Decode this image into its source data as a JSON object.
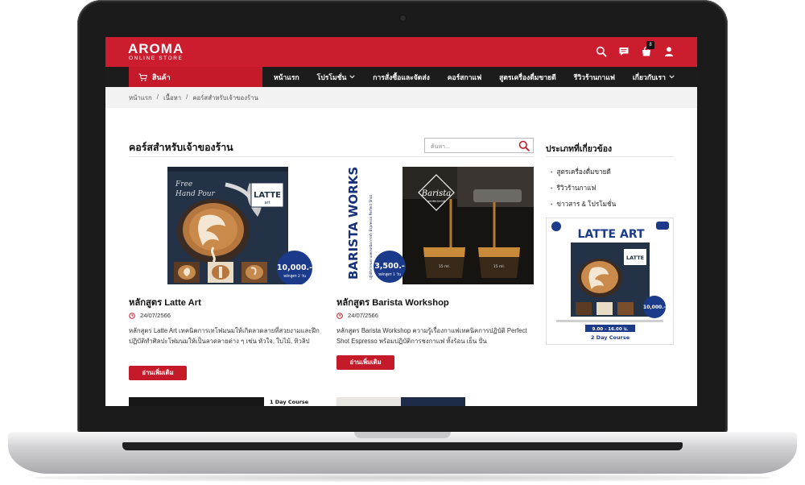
{
  "brand": {
    "name": "AROMA",
    "tagline": "ONLINE STORE"
  },
  "header": {
    "icons": [
      "search-icon",
      "chat-icon",
      "cart-icon",
      "user-icon"
    ],
    "cart_count": "8"
  },
  "nav": {
    "products_label": "สินค้า",
    "items": [
      {
        "label": "หน้าแรก",
        "dropdown": false
      },
      {
        "label": "โปรโมชั่น",
        "dropdown": true
      },
      {
        "label": "การสั่งซื้อและจัดส่ง",
        "dropdown": false
      },
      {
        "label": "คอร์สกาแฟ",
        "dropdown": false
      },
      {
        "label": "สูตรเครื่องดื่มขายดี",
        "dropdown": false
      },
      {
        "label": "รีวิวร้านกาแฟ",
        "dropdown": false
      },
      {
        "label": "เกี่ยวกับเรา",
        "dropdown": true
      }
    ]
  },
  "breadcrumb": [
    "หน้าแรก",
    "เนื้อหา",
    "คอร์สสำหรับเจ้าของร้าน"
  ],
  "page": {
    "title": "คอร์สสำหรับเจ้าของร้าน",
    "search_placeholder": "ค้นหา..."
  },
  "cards": [
    {
      "title": "หลักสูตร Latte Art",
      "date": "24/07/2566",
      "description": "หลักสูตร Latte Art เทคนิคการเทโฟมนมให้เกิดลวดลายที่สวยงามและฝึกปฏิบัติทำศิลปะโฟมนมให้เป็นลวดลายต่าง ๆ เช่น หัวใจ, ใบไม้, ทิวลิป",
      "button": "อ่านเพิ่มเติม",
      "image": {
        "script": "Free Hand Pour",
        "badge_title": "LATTE",
        "badge_sub": "art",
        "price": "10,000.-",
        "price_note": "หลักสูตร 2 วัน"
      }
    },
    {
      "title": "หลักสูตร Barista Workshop",
      "date": "24/07/2566",
      "description": "หลักสูตร Barista Workshop ความรู้เรื่องกาแฟเทคนิคการปฏิบัติ Perfect Shot Espresso พร้อมปฏิบัติการชงกาแฟ ทั้งร้อน เย็น ปั่น",
      "button": "อ่านเพิ่มเติม",
      "image": {
        "vertical_text": "BARISTA WORKSHOP",
        "vertical_sub": "ปฏิบัติการชงกาแฟเทคนิคการทำ Espresso Perfect Shot",
        "logo_title": "Barista",
        "logo_sub": "WORKSHOP",
        "price": "3,500.-",
        "price_note": "หลักสูตร 1 วัน",
        "cup_labels": [
          "15 ml.",
          "15 ml."
        ]
      }
    }
  ],
  "sidebar": {
    "title": "ประเภทที่เกี่ยวข้อง",
    "items": [
      "สูตรเครื่องดื่มขายดี",
      "รีวิวร้านกาแฟ",
      "ข่าวสาร & โปรโมชั่น"
    ],
    "banner": {
      "title": "LATTE ART",
      "price": "10,000.-",
      "badge": "LATTE",
      "time": "9.00 - 16.00 น.",
      "course": "2 Day Course"
    }
  },
  "lower": {
    "course_label": "1 Day Course"
  },
  "colors": {
    "brand_red": "#cc1d2e",
    "nav_dark": "#1c1c1c",
    "price_navy": "#1b3a8a"
  }
}
